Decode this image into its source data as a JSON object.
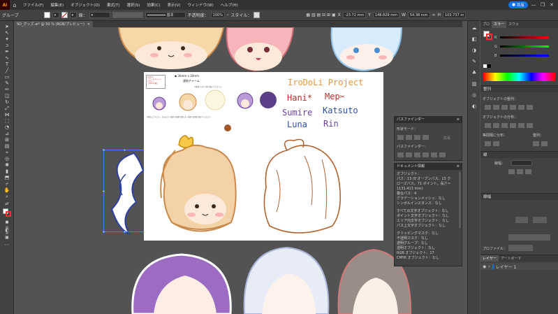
{
  "menubar": {
    "app_logo": "Ai",
    "home_icon": "home-icon",
    "items": [
      "ファイル(F)",
      "編集(E)",
      "オブジェクト(O)",
      "書式(T)",
      "選択(S)",
      "効果(C)",
      "表示(V)",
      "ウィンドウ(W)",
      "ヘルプ(H)"
    ],
    "share_label": "共有",
    "window_buttons": [
      "—",
      "❐",
      "✕"
    ]
  },
  "control_bar": {
    "selection_label": "グループ",
    "stroke_label": "線：",
    "stroke_style": "基本",
    "opacity_label": "不透明度：",
    "opacity_value": "100%",
    "style_label": "スタイル：",
    "x_label": "X",
    "x_value": "-23.72 mm",
    "y_label": "Y",
    "y_value": "148.829 mm",
    "w_label": "W",
    "w_value": "54.38 mm",
    "h_label": "H",
    "h_value": "103.737 m"
  },
  "document": {
    "tab_title": "SD_グッズ.ai* @ 50 % (RGB/プレビュー)"
  },
  "artboard": {
    "size_label": "◆ 30mm x 30mm",
    "subtitle": "連結チャーム",
    "note_small": "※線幅でのせて線で繋いでください",
    "brand_box": "IroDoLi\nアクリルチャーム\nデザイン\n【30mm角】",
    "footer_note": "※中心にアイコン、かんのり一般的で必要で描いた一般的で必要で描いてください",
    "project_title": "IroDoLi Project",
    "names": [
      "Hani*",
      "Mep✂",
      "Sumire",
      "Katsuto",
      "Luna",
      "Rin"
    ]
  },
  "pathfinder": {
    "title": "パスファインダー",
    "shape_mode_label": "形状モード：",
    "pathfinder_label": "パスファインダー：",
    "expand_label": "拡張"
  },
  "doc_info": {
    "title": "ドキュメント情報",
    "lines": [
      "オブジェクト：",
      "パス：13 (0 オープンパス，13 ク",
      "ローズパス，71 ポイント，長さ＝",
      "1131.413 mm)",
      "複合パス：4",
      "グラデーションメッシュ：なし",
      "シンボルインスタンス：なし",
      "",
      "すべての文字オブジェクト：なし",
      "ポイント文字オブジェクト：なし",
      "エリア内文字オブジェクト：なし",
      "パス上文字オブジェクト：なし",
      "",
      "クリッピングマスク：なし",
      "不透明マスク：なし",
      "透明グループ：なし",
      "透明オブジェクト：なし",
      "RGB オブジェクト：17",
      "CMYK オブジェクト：なし"
    ]
  },
  "right_panel": {
    "tabs": [
      "プロ",
      "カラー",
      "スウォ"
    ],
    "color_channels": [
      "R",
      "G",
      "B"
    ],
    "align_tab": "整列",
    "align_objects_label": "オブジェクトの整列：",
    "distribute_objects_label": "オブジェクトの分布：",
    "distribute_spacing_label": "等間隔に分布：",
    "align_to_label": "整列：",
    "stroke_tab": "線",
    "stroke_weight_label": "線幅：",
    "gradient_tab": "線幅",
    "profile_label": "プロファイル：",
    "layers_tabs": [
      "レイヤー",
      "アートボード"
    ],
    "layer_name": "レイヤー 1"
  },
  "colors": {
    "accent_blue": "#1473e6",
    "app_dark": "#323232",
    "panel_gray": "#424242",
    "canvas_gray": "#535353",
    "title_orange": "#e8963a",
    "name_red": "#b2322c",
    "name_purple": "#6a3fa0",
    "name_blue": "#2f4fa8"
  }
}
